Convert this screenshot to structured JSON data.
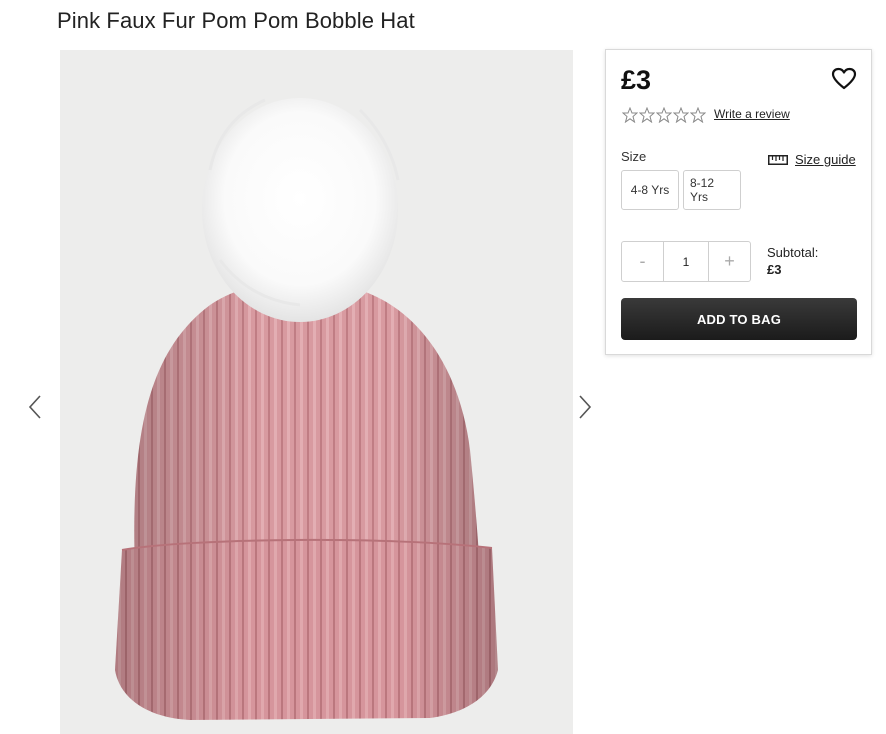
{
  "product": {
    "title": "Pink Faux Fur Pom Pom Bobble Hat",
    "image_alt": "Pink knitted bobble hat with white faux fur pom pom"
  },
  "colors": {
    "hat_pink": "#d99aa0",
    "pom_white": "#ffffff",
    "button_dark": "#222222"
  },
  "buy_box": {
    "price": "£3",
    "rating_stars": 0,
    "rating_max": 5,
    "review_link": "Write a review",
    "size_label": "Size",
    "size_guide": "Size guide",
    "sizes": [
      "4-8 Yrs",
      "8-12 Yrs"
    ],
    "qty_minus": "-",
    "qty_value": "1",
    "qty_plus": "+",
    "subtotal_label": "Subtotal:",
    "subtotal_value": "£3",
    "add_to_bag": "ADD TO BAG"
  }
}
